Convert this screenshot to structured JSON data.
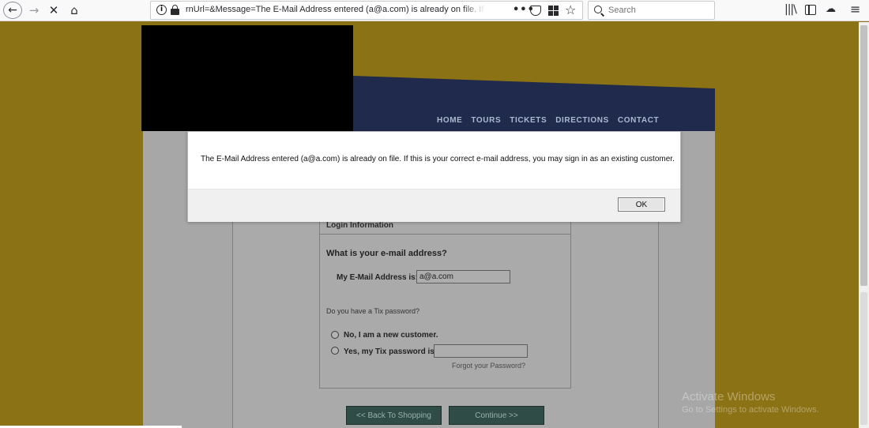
{
  "browser": {
    "url_text": "rnUrl=&Message=The E-Mail Address entered (a@a.com) is already on file. If",
    "search_placeholder": "Search",
    "url_more": "•••"
  },
  "site": {
    "nav": [
      "HOME",
      "TOURS",
      "TICKETS",
      "DIRECTIONS",
      "CONTACT"
    ]
  },
  "form": {
    "section_title": "Login Information",
    "email_question": "What is your e-mail address?",
    "email_label": "My E-Mail Address is:",
    "email_value": "a@a.com",
    "password_question": "Do you have a Tix password?",
    "radio_new": "No, I am a new customer.",
    "radio_yes": "Yes, my Tix password is:",
    "forgot_link": "Forgot your Password?",
    "back_button": "<< Back To Shopping",
    "continue_button": "Continue >>"
  },
  "dialog": {
    "message": "The E-Mail Address entered (a@a.com) is already on file. If this is your correct e-mail address, you may sign in as an existing customer.",
    "ok_label": "OK"
  },
  "watermark": {
    "title": "Activate Windows",
    "subtitle": "Go to Settings to activate Windows."
  },
  "colors": {
    "page_background": "#8b7215",
    "banner_navy": "#202a4c",
    "button_green": "#2f4d46"
  }
}
